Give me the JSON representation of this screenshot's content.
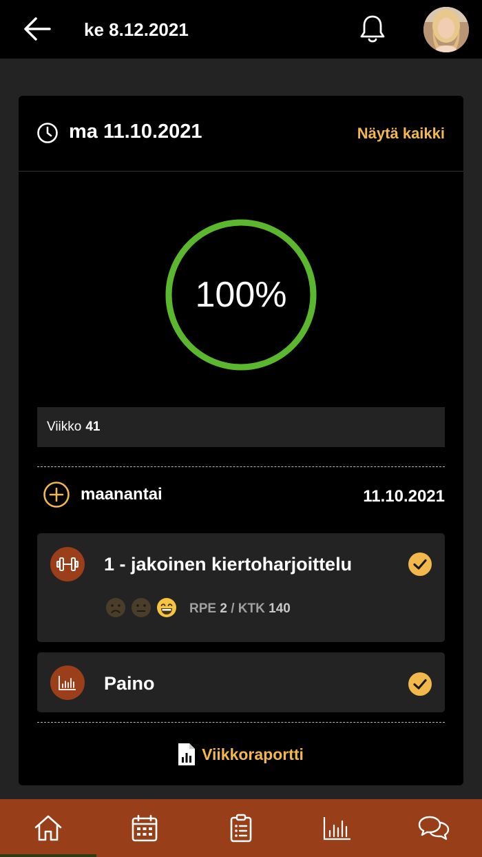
{
  "header": {
    "date": "ke 8.12.2021",
    "back_icon": "arrow-left-icon",
    "bell_icon": "bell-icon",
    "avatar": "user-avatar"
  },
  "card": {
    "date": "ma 11.10.2021",
    "show_all": "Näytä kaikki",
    "progress_label": "100%",
    "progress_value": 1.0,
    "progress_color": "#5bb82e",
    "week_label": "Viikko",
    "week_number": "41"
  },
  "day": {
    "name": "maanantai",
    "date": "11.10.2021"
  },
  "entries": [
    {
      "title": "1 - jakoinen kiertoharjoittelu",
      "icon": "dumbbell-icon",
      "completed": true,
      "rpe_label": "RPE",
      "rpe_value": "2",
      "sep": "/",
      "ktk_label": "KTK",
      "ktk_value": "140",
      "moods": [
        "sad-face-icon",
        "neutral-face-icon",
        "grinning-face-icon"
      ],
      "selected_mood": "grinning-face-icon"
    },
    {
      "title": "Paino",
      "icon": "bar-chart-icon",
      "completed": true
    }
  ],
  "report": {
    "label": "Viikkoraportti",
    "icon": "report-document-icon"
  },
  "bottom_nav": [
    "home-icon",
    "calendar-icon",
    "clipboard-list-icon",
    "stats-icon",
    "chat-icon"
  ],
  "colors": {
    "accent": "#f2b84b",
    "brand": "#983f19",
    "progress": "#5bb82e",
    "card": "#000000",
    "surface": "#232323"
  }
}
